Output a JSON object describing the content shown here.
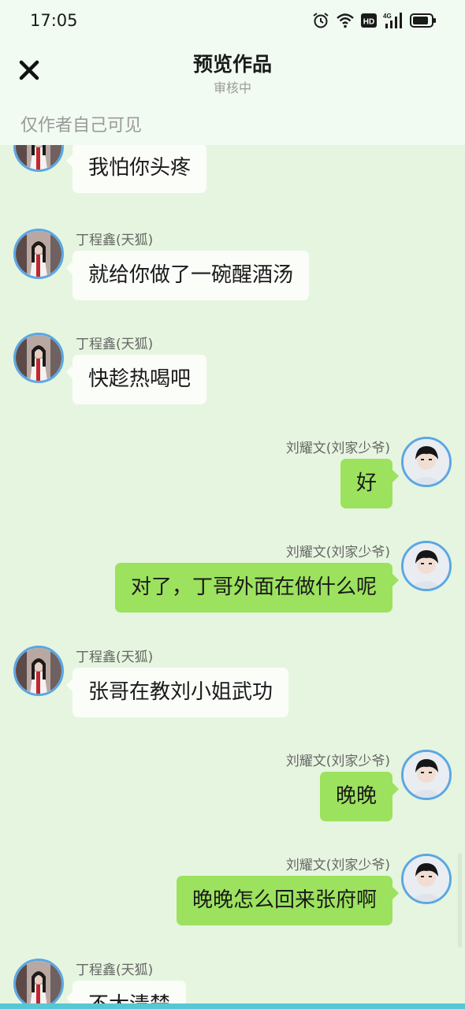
{
  "status_bar": {
    "time": "17:05",
    "icons": [
      "alarm-icon",
      "wifi-icon",
      "hd-icon",
      "4g-signal-icon",
      "battery-icon"
    ],
    "hd_label": "HD",
    "network_label": "4G"
  },
  "header": {
    "close_icon": "close-icon",
    "title": "预览作品",
    "subtitle": "审核中",
    "visibility_note": "仅作者自己可见"
  },
  "colors": {
    "background": "#e6f5df",
    "header_background": "#f1fbf1",
    "incoming_bubble": "#fbfdf9",
    "outgoing_bubble": "#9ce25e",
    "avatar_border": "#5aa7e5"
  },
  "messages": [
    {
      "side": "left",
      "sender": "",
      "text": "我怕你头疼"
    },
    {
      "side": "left",
      "sender": "丁程鑫(天狐)",
      "text": "就给你做了一碗醒酒汤"
    },
    {
      "side": "left",
      "sender": "丁程鑫(天狐)",
      "text": "快趁热喝吧"
    },
    {
      "side": "right",
      "sender": "刘耀文(刘家少爷)",
      "text": "好"
    },
    {
      "side": "right",
      "sender": "刘耀文(刘家少爷)",
      "text": "对了，丁哥外面在做什么呢"
    },
    {
      "side": "left",
      "sender": "丁程鑫(天狐)",
      "text": "张哥在教刘小姐武功"
    },
    {
      "side": "right",
      "sender": "刘耀文(刘家少爷)",
      "text": "晚晚"
    },
    {
      "side": "right",
      "sender": "刘耀文(刘家少爷)",
      "text": "晚晚怎么回来张府啊"
    },
    {
      "side": "left",
      "sender": "丁程鑫(天狐)",
      "text": "不太清楚"
    }
  ]
}
